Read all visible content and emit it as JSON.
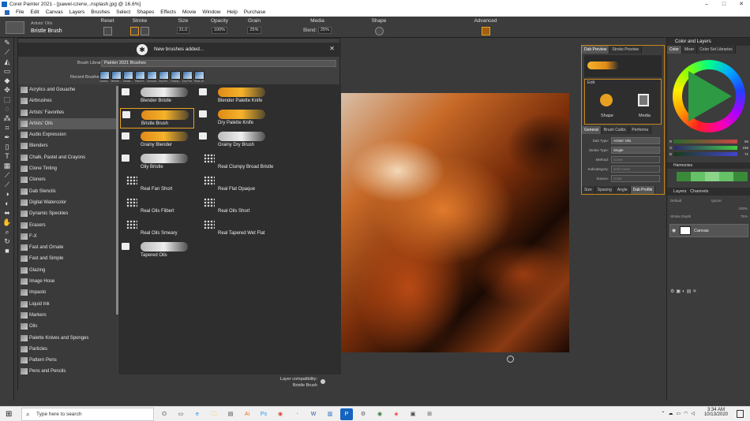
{
  "window": {
    "title": "Corel Painter 2021 - [pawel-czerw...nsplash.jpg @ 16.6%]",
    "controls": [
      "–",
      "□",
      "✕"
    ]
  },
  "menu": [
    "File",
    "Edit",
    "Canvas",
    "Layers",
    "Brushes",
    "Select",
    "Shapes",
    "Effects",
    "Movie",
    "Window",
    "Help",
    "Purchase"
  ],
  "propbar": {
    "brush_category": "Artists' Oils",
    "brush_name": "Bristle Brush",
    "reset_label": "Reset",
    "stroke_label": "Stroke",
    "size_label": "Size",
    "size_value": "31.0",
    "opacity_label": "Opacity",
    "opacity_value": "100%",
    "grain_label": "Grain",
    "grain_value": "25%",
    "media_label": "Media",
    "media_blend_label": "Blend:",
    "media_value": "25%",
    "shape_label": "Shape",
    "advanced_label": "Advanced"
  },
  "library": {
    "notice": "New brushes added...",
    "library_label": "Brush Library:",
    "library_value": "Painter 2021 Brushes",
    "recent_label": "Recent Brushes:",
    "recent": [
      "Cartoo...",
      "Bristle...",
      "Detail...",
      "Hard R...",
      "Circular...",
      "Dry Bri...",
      "Grainy...",
      "Dry Pal...",
      "Real 20..."
    ],
    "categories": [
      "Acrylics and Gouache",
      "Airbrushes",
      "Artists' Favorites",
      "Artists' Oils",
      "Audio Expression",
      "Blenders",
      "Chalk, Pastel and Crayons",
      "Clone Tinting",
      "Cloners",
      "Dab Stencils",
      "Digital Watercolor",
      "Dynamic Speckles",
      "Erasers",
      "F-X",
      "Fast and Ornate",
      "Fast and Simple",
      "Glazing",
      "Image Hose",
      "Impasto",
      "Liquid Ink",
      "Markers",
      "Oils",
      "Palette Knives and Sponges",
      "Particles",
      "Pattern Pens",
      "Pens and Pencils"
    ],
    "active_category": "Artists' Oils",
    "brushes": [
      "Blender Bristle",
      "Blender Palette Knife",
      "Bristle Brush",
      "Dry Palette Knife",
      "Grainy Blender",
      "Grainy Dry Brush",
      "Oily Bristle",
      "Real Clumpy Broad Bristle",
      "Real Fan Short",
      "Real Flat Opaque",
      "Real Oils Filbert",
      "Real Oils Short",
      "Real Oils Smeary",
      "Real Tapered Wet Flat",
      "Tapered Oils"
    ],
    "selected_brush": "Bristle Brush",
    "footer_compat": "Layer compatibility:",
    "footer_brush": "Bristle Brush"
  },
  "dab_panel": {
    "tabs": [
      "Dab Preview",
      "Stroke Preview"
    ],
    "edit_label": "Edit",
    "shape_label": "Shape",
    "media_label": "Media",
    "sub_tabs": [
      "General",
      "Brush Calibr.",
      "Performa"
    ],
    "fields": [
      {
        "k": "Dab Type:",
        "v": "Artists' Oils"
      },
      {
        "k": "Stroke Type:",
        "v": "Single"
      },
      {
        "k": "Method:",
        "v": "Cover"
      },
      {
        "k": "Subcategory:",
        "v": "Soft Cover"
      },
      {
        "k": "Source:",
        "v": "Color"
      }
    ],
    "bottom_tabs": [
      "Size",
      "Spacing",
      "Angle",
      "Dab Profile"
    ]
  },
  "color_panel": {
    "title": "Color and Layers",
    "tabs": [
      "Color",
      "Mixer",
      "Color Set Libraries"
    ],
    "rgb": [
      {
        "ch": "R",
        "val": "66"
      },
      {
        "ch": "G",
        "val": "166"
      },
      {
        "ch": "B",
        "val": "71"
      }
    ],
    "harmonies_label": "Harmonies",
    "harmony_colors": [
      "#3a8a3a",
      "#66c266",
      "#8ad48a",
      "#66c266",
      "#3a8a3a"
    ]
  },
  "layers_panel": {
    "tabs": [
      "Layers",
      "Channels"
    ],
    "blend": "Default",
    "composite": "Ignore",
    "opacity": "100%",
    "stroke_depth_label": "Stroke Depth",
    "stroke_depth": "75%",
    "layer_name": "Canvas"
  },
  "taskbar": {
    "search_placeholder": "Type here to search",
    "time": "3:34 AM",
    "date": "10/13/2020",
    "apps": [
      "⭘",
      "▭",
      "e",
      "🗀",
      "▤",
      "Ai",
      "Ps",
      "◉",
      "◔",
      "W",
      "▥",
      "P",
      "⚙",
      "◉",
      "◈",
      "▣",
      "⊞"
    ]
  },
  "colors": {
    "accent": "#e8a020",
    "panel_bg": "#3c3c3c",
    "library_bg": "#404040"
  }
}
